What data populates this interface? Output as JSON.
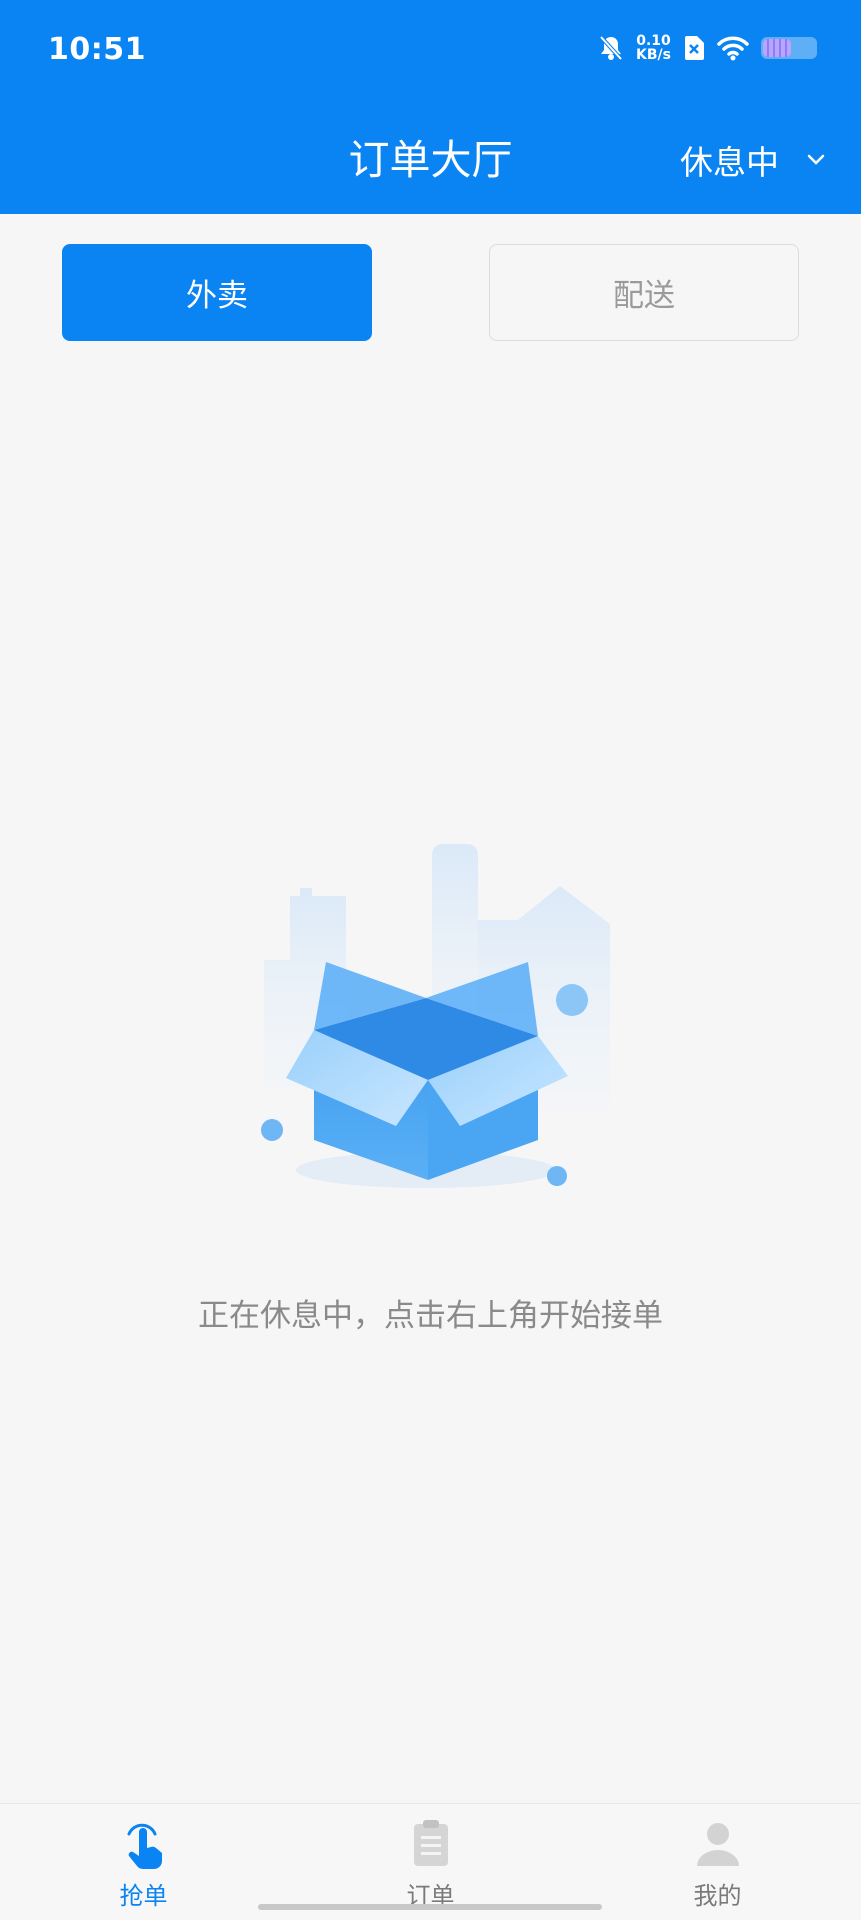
{
  "status_bar": {
    "time": "10:51",
    "net_speed_value": "0.10",
    "net_speed_unit": "KB/s",
    "icons": [
      "bell-muted-icon",
      "sim-off-icon",
      "wifi-icon",
      "battery-icon"
    ]
  },
  "header": {
    "title": "订单大厅",
    "status_label": "休息中",
    "status_icon": "chevron-down-icon",
    "background": "#0a84f3"
  },
  "tabs": {
    "takeout": "外卖",
    "delivery": "配送",
    "selected": "takeout"
  },
  "empty_state": {
    "icon": "empty-box-illustration",
    "message": "正在休息中，点击右上角开始接单"
  },
  "tabbar": {
    "items": [
      {
        "label": "抢单",
        "icon": "tap-hand-icon",
        "selected": true
      },
      {
        "label": "订单",
        "icon": "clipboard-icon",
        "selected": false
      },
      {
        "label": "我的",
        "icon": "user-icon",
        "selected": false
      }
    ],
    "accent": "#0a84f3"
  }
}
